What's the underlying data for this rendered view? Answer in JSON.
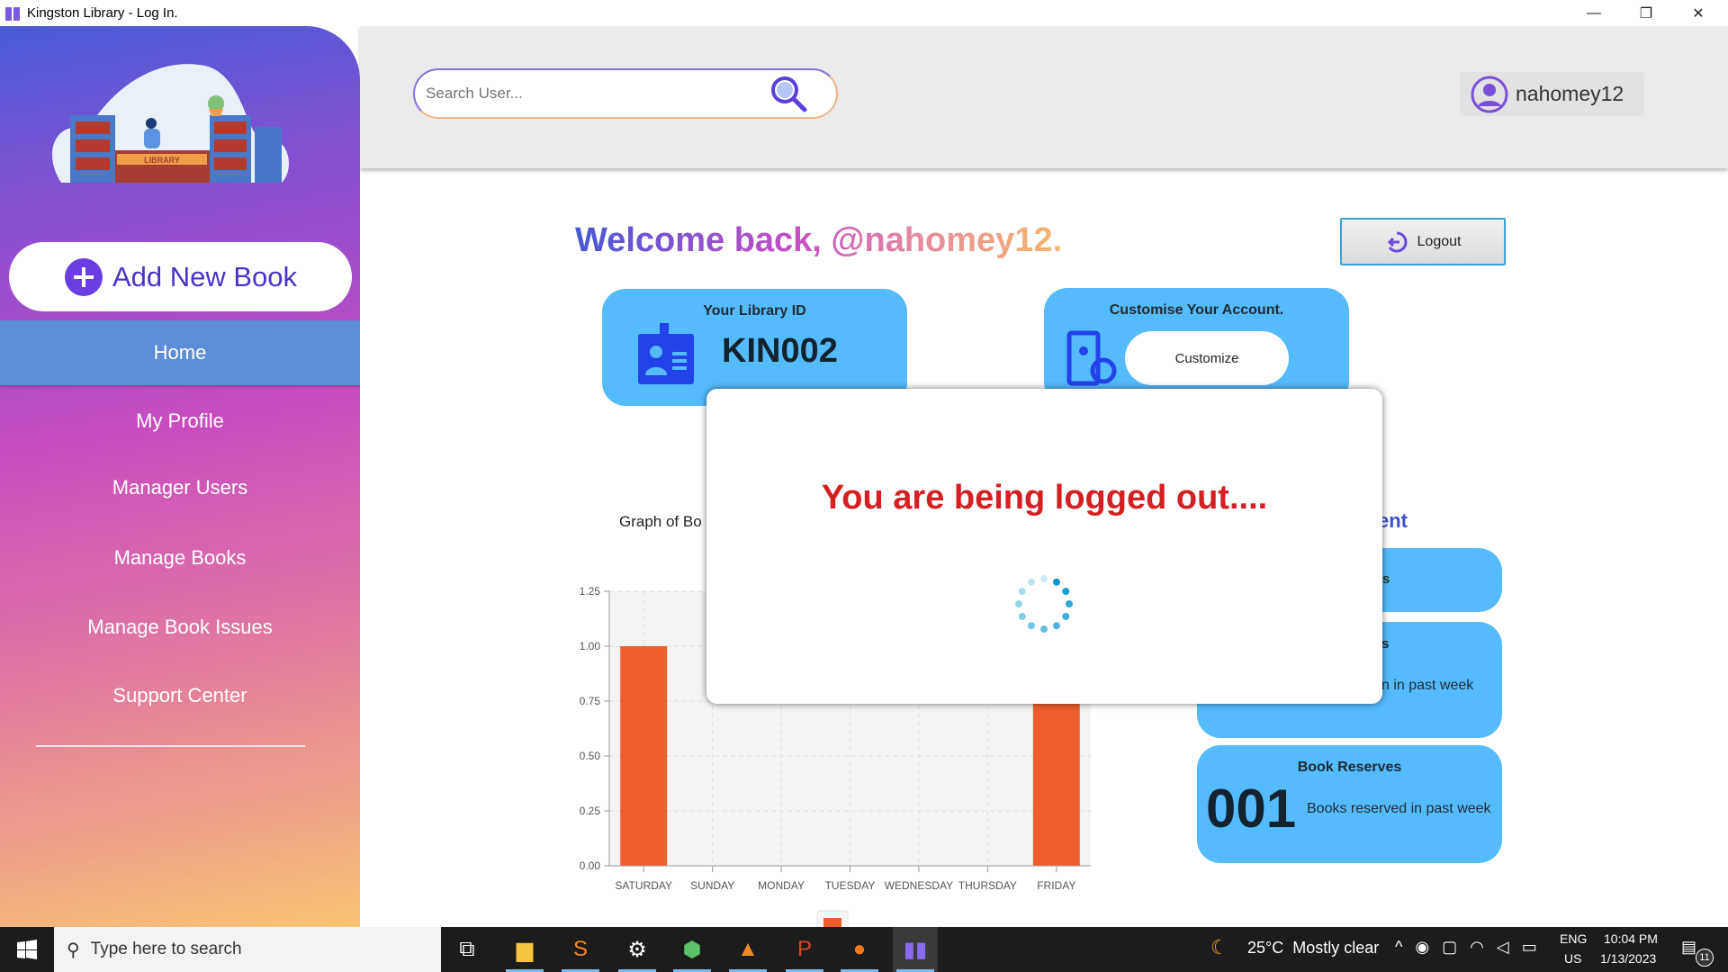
{
  "window": {
    "title": "Kingston Library -  Log In.",
    "minimize": "—",
    "restore": "❐",
    "close": "✕"
  },
  "header": {
    "search_placeholder": "Search User...",
    "username": "nahomey12"
  },
  "sidebar": {
    "add_button": "Add New Book",
    "items": [
      {
        "label": "Home",
        "active": true
      },
      {
        "label": "My Profile"
      },
      {
        "label": "Manager Users"
      },
      {
        "label": "Manage Books"
      },
      {
        "label": "Manage Book Issues"
      },
      {
        "label": "Support Center"
      }
    ]
  },
  "main": {
    "welcome": "Welcome back, @nahomey12.",
    "logout": "Logout",
    "library_id_card": {
      "title": "Your Library ID",
      "value": "KIN002"
    },
    "customise_card": {
      "title": "Customise Your Account.",
      "button": "Customize"
    },
    "graph_title_fragment": "Graph of Bo",
    "right_heading_fragment": "ent",
    "stat_card_1_fragment": "rs",
    "stat_card_2_title_fragment": "s",
    "stat_card_2_desc_fragment": "n in past week",
    "book_reserves": {
      "title": "Book Reserves",
      "value": "001",
      "desc": "Books reserved in past week"
    }
  },
  "modal": {
    "message": "You are being logged out...."
  },
  "chart_data": {
    "type": "bar",
    "categories": [
      "SATURDAY",
      "SUNDAY",
      "MONDAY",
      "TUESDAY",
      "WEDNESDAY",
      "THURSDAY",
      "FRIDAY"
    ],
    "values": [
      1,
      0,
      0,
      0,
      0,
      0,
      1
    ],
    "ylim": [
      0,
      1.25
    ],
    "yticks": [
      "0.00",
      "0.25",
      "0.50",
      "0.75",
      "1.00",
      "1.25"
    ],
    "grid": true,
    "color": "#ef5f2e",
    "legend": "bottom"
  },
  "taskbar": {
    "search_placeholder": "Type here to search",
    "weather": "25°C  Mostly clear",
    "lang1": "ENG",
    "lang2": "US",
    "time": "10:04 PM",
    "date": "1/13/2023",
    "notifications": "11"
  },
  "colors": {
    "card": "#55bbfd",
    "accent": "#4a33c8",
    "modal_text": "#d41f23"
  }
}
